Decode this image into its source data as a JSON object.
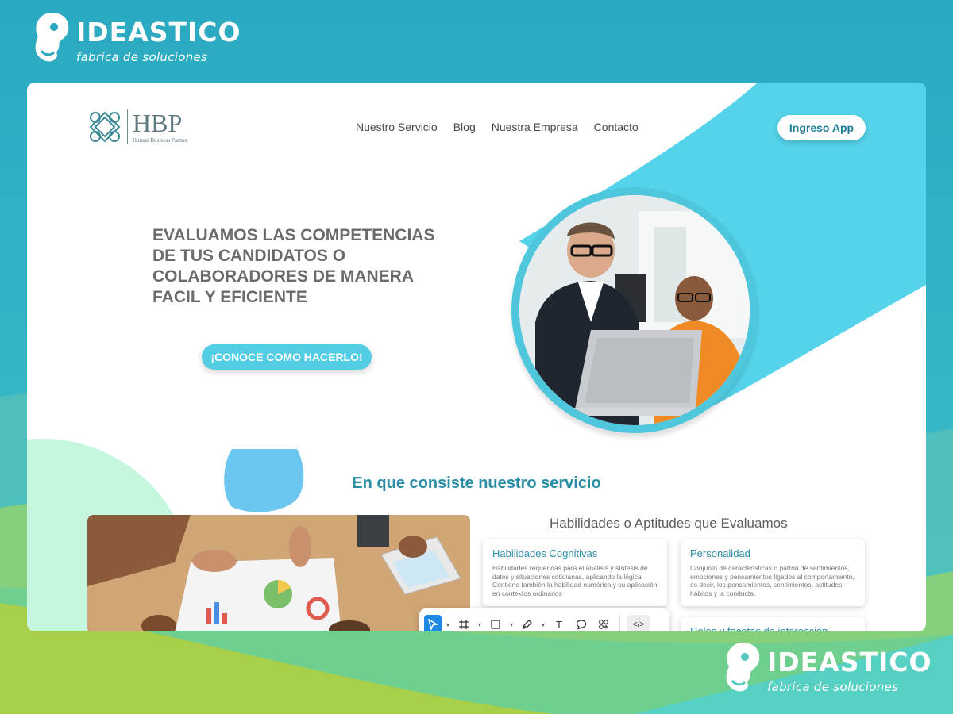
{
  "brand": {
    "name": "IDEASTICO",
    "tagline": "fabrica de soluciones"
  },
  "site": {
    "logo": {
      "name": "HBP",
      "subtitle": "Human Business Partner"
    },
    "nav": [
      "Nuestro Servicio",
      "Blog",
      "Nuestra Empresa",
      "Contacto"
    ],
    "login_label": "Ingreso App",
    "hero": {
      "title": "EVALUAMOS LAS COMPETENCIAS DE TUS CANDIDATOS O COLABORADORES DE MANERA FACIL Y EFICIENTE",
      "cta_label": "¡CONOCE COMO HACERLO!"
    },
    "service": {
      "title": "En que consiste nuestro servicio",
      "skills_title": "Habilidades o Aptitudes que Evaluamos",
      "cards": [
        {
          "title": "Habilidades Cognitivas",
          "desc": "Habilidades requeridas para el análisis y síntesis de datos  y situaciones cotidianas, aplicando la lógica. Contiene también la habilidad numérica y su aplicación en contextos ordinarios"
        },
        {
          "title": "Personalidad",
          "desc": "Conjunto de características o patrón de sentimientos, emociones y pensamientos ligados al comportamiento, es decir, los pensamientos, sentimientos, actitudes, hábitos y la conducta."
        },
        {
          "title": "Roles y facetas de interacción",
          "desc": ""
        }
      ]
    }
  },
  "toolbar": {
    "tools": [
      "select-tool",
      "frame-tool",
      "shape-tool",
      "pen-tool",
      "text-tool",
      "comment-tool",
      "components-tool",
      "dev-mode-tool"
    ],
    "text_glyph": "T",
    "code_glyph": "</>"
  },
  "colors": {
    "page_bg": "#2eb1c4",
    "accent": "#52cde3",
    "heading": "#2a8ea6",
    "toolbar_active": "#1e88e5"
  }
}
